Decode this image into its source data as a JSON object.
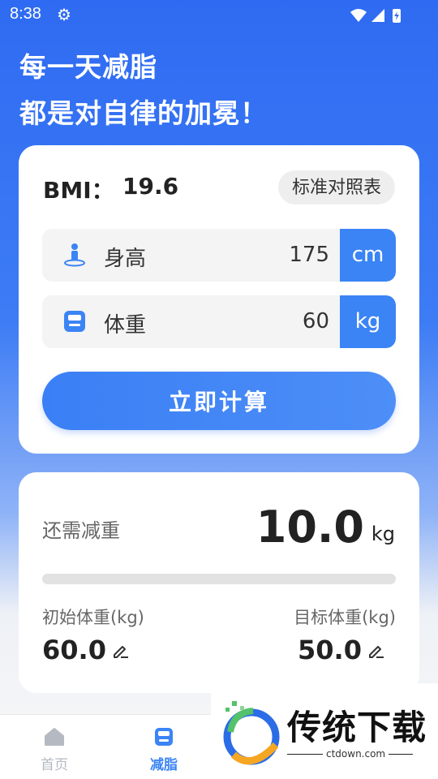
{
  "status_bar": {
    "time": "8:38"
  },
  "slogan": {
    "line1": "每一天减脂",
    "line2": "都是对自律的加冕！"
  },
  "bmi_card": {
    "bmi_label": "BMI：",
    "bmi_value": "19.6",
    "chart_button": "标准对照表",
    "height": {
      "label": "身高",
      "value": "175",
      "unit": "cm"
    },
    "weight": {
      "label": "体重",
      "value": "60",
      "unit": "kg"
    },
    "calculate_button": "立即计算"
  },
  "goal_card": {
    "remaining_label": "还需减重",
    "remaining_value": "10.0",
    "remaining_unit": "kg",
    "progress_fraction": 0,
    "initial_label": "初始体重(kg)",
    "initial_value": "60.0",
    "target_label": "目标体重(kg)",
    "target_value": "50.0"
  },
  "tabbar": {
    "tabs": [
      {
        "label": "首页",
        "active": false
      },
      {
        "label": "减脂",
        "active": true
      }
    ]
  },
  "watermark": {
    "text": "传统下载",
    "url": "ctdown.com"
  },
  "colors": {
    "accent": "#3b84f5",
    "tab_inactive": "#b5b9c2"
  }
}
